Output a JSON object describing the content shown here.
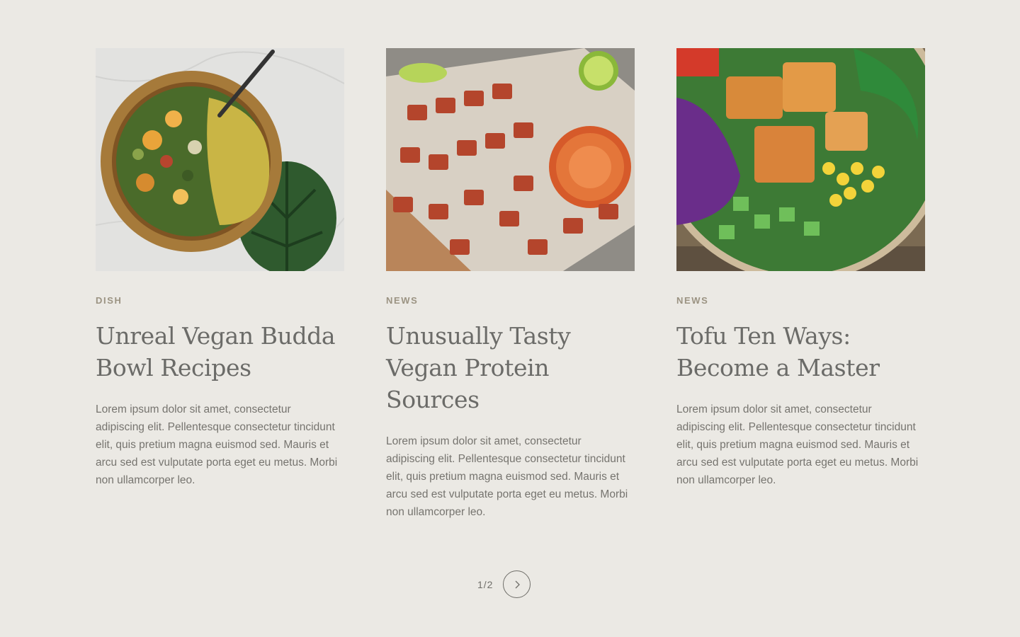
{
  "posts": [
    {
      "category": "DISH",
      "title": "Unreal Vegan Budda Bowl Recipes",
      "excerpt": "Lorem ipsum dolor sit amet, consectetur adipiscing elit. Pellentesque consectetur tincidunt elit, quis pretium magna euismod sed. Mauris et arcu sed est vulputate porta eget eu metus. Morbi non ullamcorper leo."
    },
    {
      "category": "NEWS",
      "title": "Unusually Tasty Vegan Protein Sources",
      "excerpt": "Lorem ipsum dolor sit amet, consectetur adipiscing elit. Pellentesque consectetur tincidunt elit, quis pretium magna euismod sed. Mauris et arcu sed est vulputate porta eget eu metus. Morbi non ullamcorper leo."
    },
    {
      "category": "NEWS",
      "title": "Tofu Ten Ways: Become a Master",
      "excerpt": "Lorem ipsum dolor sit amet, consectetur adipiscing elit. Pellentesque consectetur tincidunt elit, quis pretium magna euismod sed. Mauris et arcu sed est vulputate porta eget eu metus. Morbi non ullamcorper leo."
    }
  ],
  "pagination": {
    "label": "1/2",
    "next_icon": "chevron-right-icon"
  },
  "colors": {
    "background": "#ebe9e4",
    "category": "#9b9382",
    "title": "#6b6b68",
    "body_text": "#76746f"
  }
}
